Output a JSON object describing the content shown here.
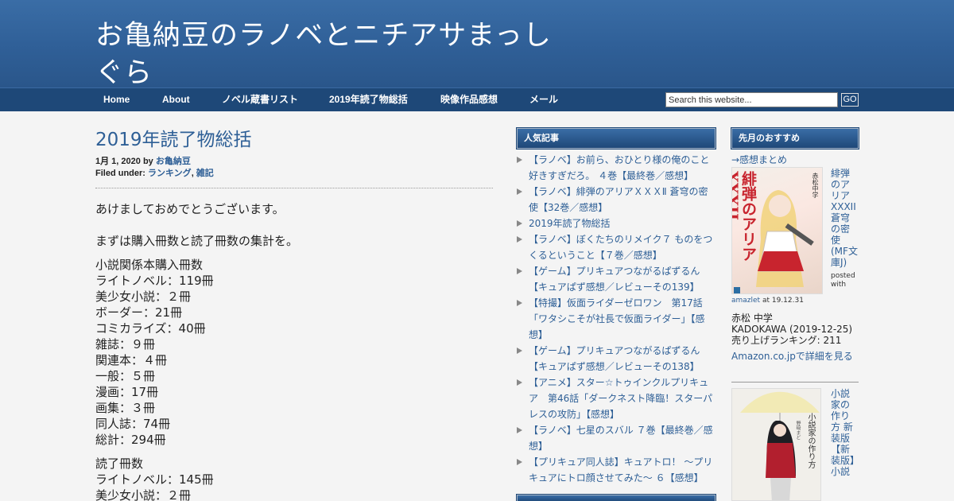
{
  "site": {
    "title": "お亀納豆のラノベとニチアサまっしぐら"
  },
  "nav": {
    "items": [
      "Home",
      "About",
      "ノベル蔵書リスト",
      "2019年読了物総括",
      "映像作品感想",
      "メール"
    ],
    "search_placeholder": "Search this website...",
    "search_button": "GO"
  },
  "post": {
    "title": "2019年読了物総括",
    "date": "1月 1, 2020",
    "by": "by",
    "author": "お亀納豆",
    "filed_label": "Filed under:",
    "categories": [
      "ランキング",
      "雑記"
    ],
    "greeting": "あけましておめでとうございます。",
    "intro": "まずは購入冊数と読了冊数の集計を。",
    "purchase_lines": [
      "小説関係本購入冊数",
      "ライトノベル：119冊",
      "美少女小説：２冊",
      "ボーダー：21冊",
      "コミカライズ：40冊",
      "雑誌：９冊",
      "関連本：４冊",
      "一般：５冊",
      "漫画：17冊",
      "画集：３冊",
      "同人誌：74冊",
      "総計：294冊"
    ],
    "read_lines": [
      "読了冊数",
      "ライトノベル：145冊",
      "美少女小説：２冊"
    ]
  },
  "popular": {
    "title": "人気記事",
    "items": [
      "【ラノベ】お前ら、おひとり様の俺のこと好きすぎだろ。 ４巻【最終巻／感想】",
      "【ラノベ】緋弾のアリアＸＸＸⅡ 蒼穹の密使【32巻／感想】",
      "2019年読了物総括",
      "【ラノベ】ぼくたちのリメイク７ ものをつくるということ【７巻／感想】",
      "【ゲーム】プリキュアつながるぱずるん【キュアぱず感想／レビューその139】",
      "【特撮】仮面ライダーゼロワン　第17話「ワタシこそが社長で仮面ライダー」【感想】",
      "【ゲーム】プリキュアつながるぱずるん【キュアぱず感想／レビューその138】",
      "【アニメ】スター☆トゥインクルプリキュア　第46話「ダークネスト降臨！スターパレスの攻防」【感想】",
      "【ラノベ】七星のスバル ７巻【最終巻／感想】",
      "【プリキュア同人誌】キュアトロ！ ～プリキュアにトロ顔させてみた～ ６【感想】"
    ]
  },
  "recommend": {
    "title": "先月のおすすめ",
    "link": "→感想まとめ",
    "book1": {
      "title": "緋弾のアリアXXXII 蒼穹の密使 (MF文庫J)",
      "posted_with": "posted with",
      "amazlet": "amazlet",
      "at": "at 19.12.31",
      "author": "赤松 中学",
      "publisher": "KADOKAWA (2019-12-25)",
      "rank": "売り上げランキング: 211",
      "amazon_link": "Amazon.co.jpで詳細を見る",
      "cover_text": "緋弾のアリアXXXII",
      "cover_author": "赤松中学"
    },
    "book2": {
      "title": "小説家の作り方 新装版【新装版】小説",
      "cover_text": "小説家の作り方",
      "cover_author": "野﨑まど"
    }
  },
  "colors": {
    "header": "#2f5f97",
    "nav": "#1e4878",
    "link": "#2e5f96",
    "background": "#f4f4f4"
  }
}
